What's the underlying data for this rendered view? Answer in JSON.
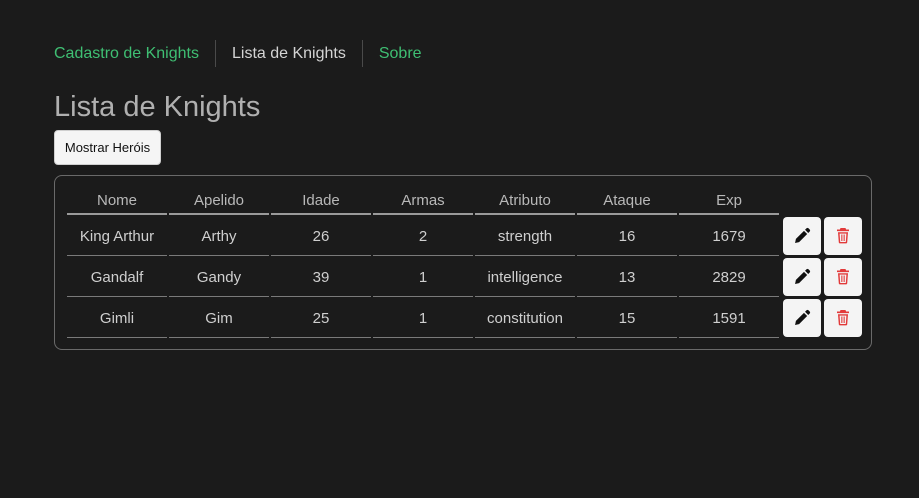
{
  "nav": {
    "items": [
      {
        "label": "Cadastro de Knights",
        "style": "link"
      },
      {
        "label": "Lista de Knights",
        "style": "current"
      },
      {
        "label": "Sobre",
        "style": "link"
      }
    ]
  },
  "page": {
    "title": "Lista de Knights",
    "show_button": "Mostrar Heróis"
  },
  "table": {
    "headers": [
      "Nome",
      "Apelido",
      "Idade",
      "Armas",
      "Atributo",
      "Ataque",
      "Exp"
    ],
    "rows": [
      [
        "King Arthur",
        "Arthy",
        "26",
        "2",
        "strength",
        "16",
        "1679"
      ],
      [
        "Gandalf",
        "Gandy",
        "39",
        "1",
        "intelligence",
        "13",
        "2829"
      ],
      [
        "Gimli",
        "Gim",
        "25",
        "1",
        "constitution",
        "15",
        "1591"
      ]
    ],
    "row_actions": [
      {
        "icon": "pencil-icon",
        "action": "edit"
      },
      {
        "icon": "trash-icon",
        "action": "delete"
      }
    ]
  },
  "colors": {
    "background": "#1b1b1b",
    "link_green": "#3fbf73",
    "delete_red": "#e23a3a",
    "edit_icon": "#111111"
  }
}
